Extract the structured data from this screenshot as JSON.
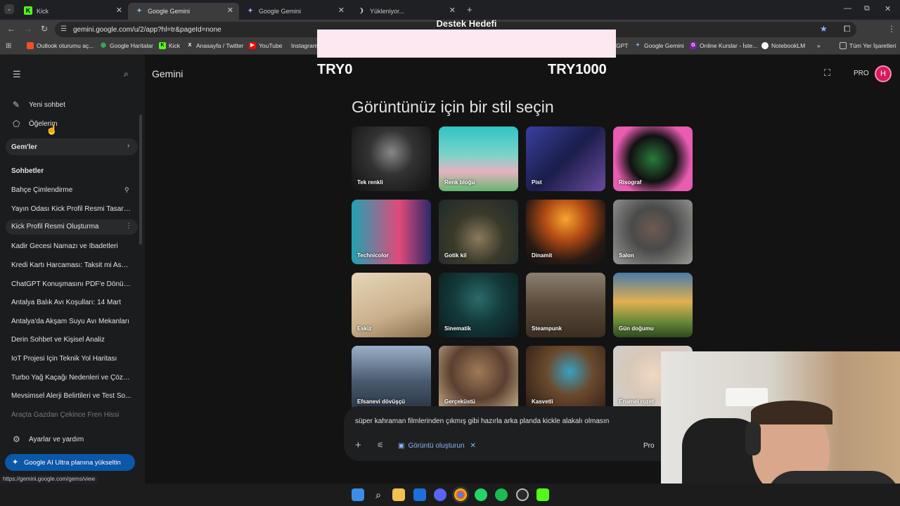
{
  "browser": {
    "tabs": [
      {
        "title": "Kick",
        "favicon": "kick-icon"
      },
      {
        "title": "Google Gemini",
        "favicon": "gemini-icon"
      },
      {
        "title": "Google Gemini",
        "favicon": "gemini-icon"
      },
      {
        "title": "Yükleniyor...",
        "favicon": "loading-icon"
      }
    ],
    "url": "gemini.google.com/u/2/app?hl=tr&pageId=none",
    "bookmarks": [
      "Outlook oturumu aç...",
      "Google Haritalar",
      "Kick",
      "Anasayfa / Twitter",
      "YouTube",
      "Instagram",
      "GPT",
      "Google Gemini",
      "Online Kurslar - İste...",
      "NotebookLM"
    ],
    "all_bookmarks": "Tüm Yer İşaretleri",
    "status_url": "https://gemini.google.com/gems/view"
  },
  "overlay": {
    "title": "Destek Hedefi",
    "left_value": "TRY0",
    "right_value": "TRY1000"
  },
  "sidebar": {
    "new_chat": "Yeni sohbet",
    "my_items": "Öğelerim",
    "gems": "Gem'ler",
    "chats_header": "Sohbetler",
    "chats": [
      "Bahçe Çimlendirme",
      "Yayın Odası Kick Profil Resmi Tasarımı",
      "Kick Profil Resmi Oluşturma",
      "Kadir Gecesi Namazı ve İbadetleri",
      "Kredi Kartı Harcaması: Taksit mi Asga...",
      "ChatGPT Konuşmasını PDF'e Dönüştü...",
      "Antalya Balık Avı Koşulları: 14 Mart",
      "Antalya'da Akşam Suyu Avı Mekanları",
      "Derin Sohbet ve Kişisel Analiz",
      "IoT Projesi İçin Teknik Yol Haritası",
      "Turbo Yağ Kaçağı Nedenleri ve Çözü...",
      "Mevsimsel Alerji Belirtileri ve Test So...",
      "Araçta Gazdan Çekince Fren Hissi"
    ],
    "settings": "Ayarlar ve yardım",
    "upgrade": "Google AI Ultra planına yükseltin"
  },
  "header": {
    "app_name": "Gemini",
    "pro_label": "PRO",
    "avatar": "H"
  },
  "main": {
    "heading": "Görüntünüz için bir stil seçin",
    "styles": [
      "Tek renkli",
      "Renk bloğu",
      "Pist",
      "Risograf",
      "Technicolor",
      "Gotik kil",
      "Dinamit",
      "Salon",
      "Eskiz",
      "Sinematik",
      "Steampunk",
      "Gün doğumu",
      "Efsanevi dövüşçü",
      "Gerçeküstü",
      "Kasvetli",
      "Enamel rozet"
    ],
    "prompt_text": "süper kahraman filmlerinden çıkmış gibi hazırla arka planda kickle alakalı olmasın",
    "tool_chip": "Görüntü oluşturun",
    "model": "Pro"
  },
  "colors": {
    "accent": "#1f6feb",
    "avatar_bg": "#d81b60",
    "upgrade_bg": "#0b57a8"
  }
}
